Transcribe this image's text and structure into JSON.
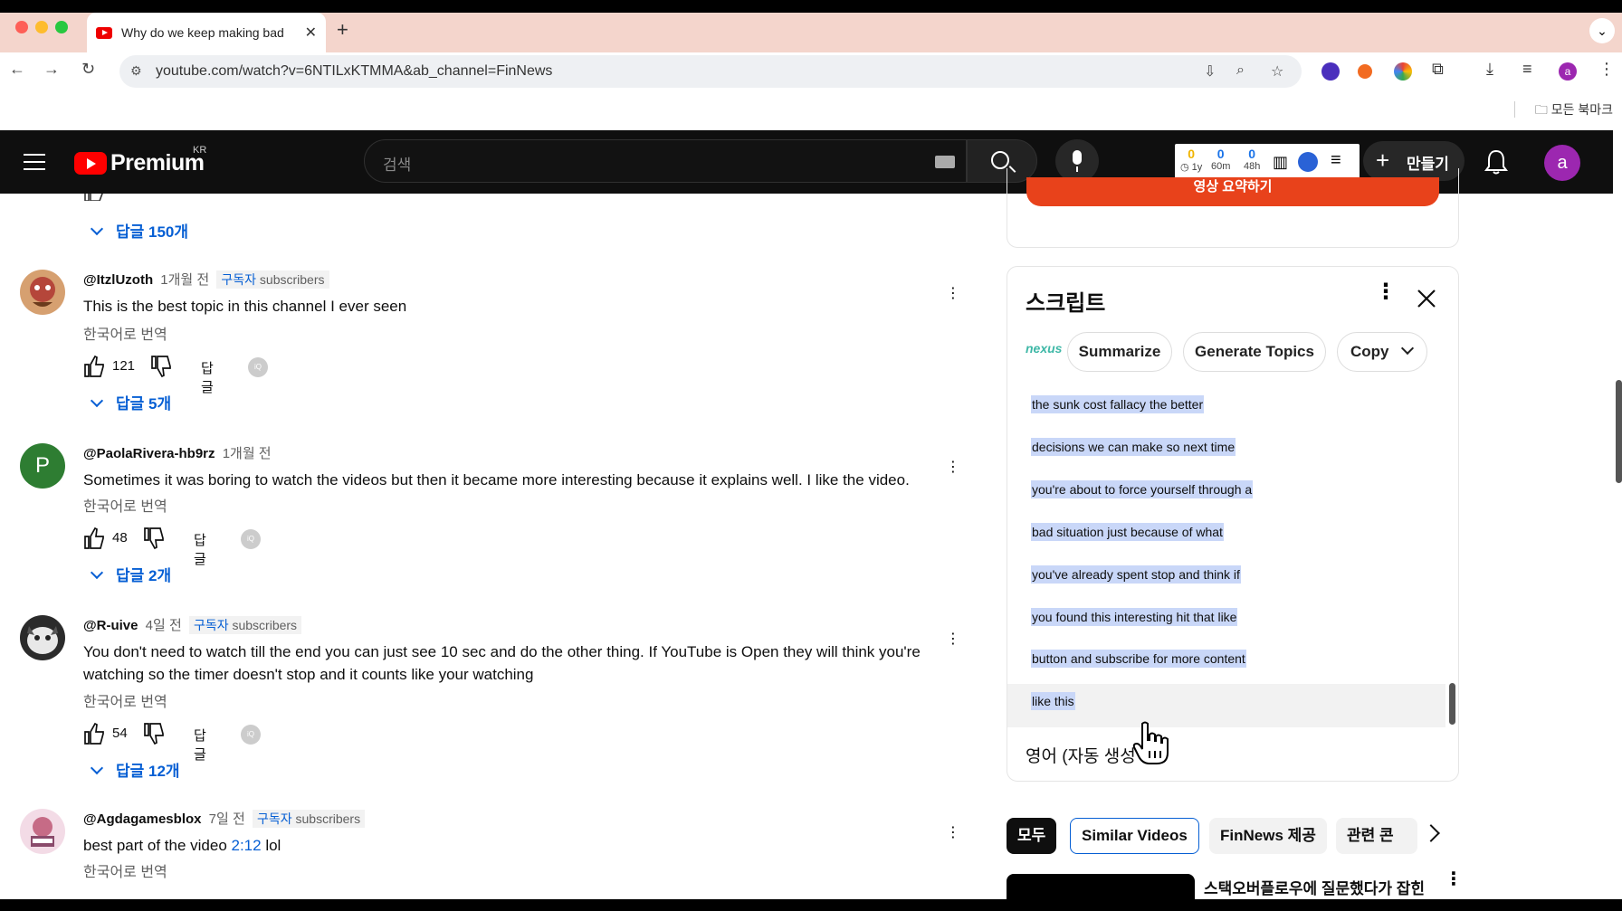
{
  "browser": {
    "tab_title": "Why do we keep making bad",
    "url": "youtube.com/watch?v=6NTILxKTMMA&ab_channel=FinNews",
    "bookmarks_label": "모든 북마크"
  },
  "header": {
    "logo_text": "Premium",
    "region": "KR",
    "search_placeholder": "검색",
    "stats": [
      {
        "value": "0",
        "label": "1y",
        "color": "#f0b400"
      },
      {
        "value": "0",
        "label": "60m",
        "color": "#1a73e8"
      },
      {
        "value": "0",
        "label": "48h",
        "color": "#1a73e8"
      }
    ],
    "create_label": "만들기",
    "avatar_letter": "a"
  },
  "comments": {
    "top_replies": "답글 150개",
    "translate_label": "한국어로 번역",
    "reply_label": "답글",
    "items": [
      {
        "handle": "@ItzlUzoth",
        "time": "1개월 전",
        "badge_ko": "구독자",
        "badge_en": "subscribers",
        "text": "This is the best topic in this channel I ever seen",
        "likes": "121",
        "replies": "답글 5개"
      },
      {
        "handle": "@PaolaRivera-hb9rz",
        "time": "1개월 전",
        "avatar_letter": "P",
        "text": "Sometimes it was boring to watch the videos but then it became more interesting because it explains well. I like the video.",
        "likes": "48",
        "replies": "답글 2개"
      },
      {
        "handle": "@R-uive",
        "time": "4일 전",
        "badge_ko": "구독자",
        "badge_en": "subscribers",
        "text": "You don't need to watch till the end you can just see 10 sec and do the other thing. If YouTube is Open they will think you're watching so the timer doesn't stop and it counts like your watching",
        "likes": "54",
        "replies": "답글 12개"
      },
      {
        "handle": "@Agdagamesblox",
        "time": "7일 전",
        "badge_ko": "구독자",
        "badge_en": "subscribers",
        "text_before": "best part of the video ",
        "timestamp": "2:12",
        "text_after": "  lol"
      }
    ]
  },
  "summary": {
    "button_label": "영상 요약하기"
  },
  "script": {
    "title": "스크립트",
    "buttons": {
      "summarize": "Summarize",
      "topics": "Generate Topics",
      "copy": "Copy"
    },
    "logo_text": "nexus",
    "segments": [
      "the sunk cost fallacy the better",
      "decisions we can make so next time",
      "you're about to force yourself through a",
      "bad situation just because of what",
      "you've already spent stop and think if",
      "you found this interesting hit that like",
      "button and subscribe for more content",
      "like this"
    ],
    "language": "영어 (자동 생성"
  },
  "chips": [
    "모두",
    "Similar Videos",
    "FinNews 제공",
    "관련 콘"
  ],
  "recommendation": {
    "title": "스택오버플로우에 질문했다가 잡힌"
  }
}
